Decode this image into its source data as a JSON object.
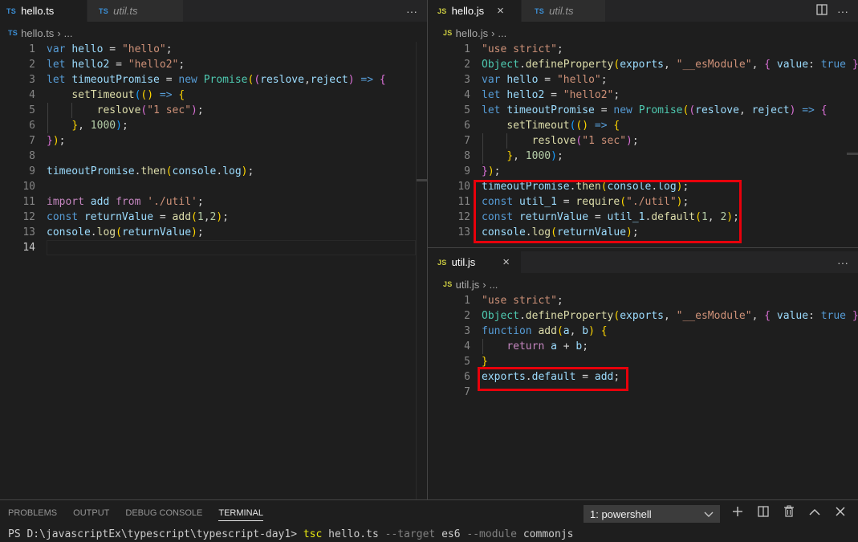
{
  "left_editor": {
    "tabs": [
      {
        "badge": "TS",
        "name": "hello.ts",
        "active": true
      },
      {
        "badge": "TS",
        "name": "util.ts",
        "active": false
      }
    ],
    "more_icon": "ellipsis-icon",
    "breadcrumb": {
      "badge": "TS",
      "file": "hello.ts",
      "rest": "..."
    },
    "lines": [
      {
        "n": "1",
        "html": "<span class=\"kw\">var</span> <span class=\"var\">hello</span> = <span class=\"str\">\"hello\"</span>;"
      },
      {
        "n": "2",
        "html": "<span class=\"kw\">let</span> <span class=\"var\">hello2</span> = <span class=\"str\">\"hello2\"</span>;"
      },
      {
        "n": "3",
        "html": "<span class=\"kw\">let</span> <span class=\"var\">timeoutPromise</span> = <span class=\"kw\">new</span> <span class=\"cls\">Promise</span><span class=\"p3\">(</span><span class=\"p1\">(</span><span class=\"var\">reslove</span>,<span class=\"var\">reject</span><span class=\"p1\">)</span> <span class=\"kw\">=&gt;</span> <span class=\"p1\">{</span>"
      },
      {
        "n": "4",
        "html": "    <span class=\"fn\">setTimeout</span><span class=\"p2\">(</span><span class=\"p3\">()</span> <span class=\"kw\">=&gt;</span> <span class=\"p3\">{</span>"
      },
      {
        "n": "5",
        "html": "        <span class=\"fn\">reslove</span><span class=\"p1\">(</span><span class=\"str\">\"1 sec\"</span><span class=\"p1\">)</span>;"
      },
      {
        "n": "6",
        "html": "    <span class=\"p3\">}</span>, <span class=\"num\">1000</span><span class=\"p2\">)</span>;"
      },
      {
        "n": "7",
        "html": "<span class=\"p1\">}</span><span class=\"p3\">)</span>;"
      },
      {
        "n": "8",
        "html": ""
      },
      {
        "n": "9",
        "html": "<span class=\"var\">timeoutPromise</span>.<span class=\"fn\">then</span><span class=\"p3\">(</span><span class=\"var\">console</span>.<span class=\"var\">log</span><span class=\"p3\">)</span>;"
      },
      {
        "n": "10",
        "html": ""
      },
      {
        "n": "11",
        "html": "<span class=\"ctl\">import</span> <span class=\"var\">add</span> <span class=\"ctl\">from</span> <span class=\"str\">'./util'</span>;"
      },
      {
        "n": "12",
        "html": "<span class=\"kw\">const</span> <span class=\"var\">returnValue</span> = <span class=\"fn\">add</span><span class=\"p3\">(</span><span class=\"num\">1</span>,<span class=\"num\">2</span><span class=\"p3\">)</span>;"
      },
      {
        "n": "13",
        "html": "<span class=\"var\">console</span>.<span class=\"fn\">log</span><span class=\"p3\">(</span><span class=\"var\">returnValue</span><span class=\"p3\">)</span>;"
      },
      {
        "n": "14",
        "html": ""
      }
    ]
  },
  "right_top_editor": {
    "tabs": [
      {
        "badge": "JS",
        "name": "hello.js",
        "active": true,
        "close": "×"
      },
      {
        "badge": "TS",
        "name": "util.ts",
        "active": false
      }
    ],
    "split_icon": "split-editor-icon",
    "more_icon": "ellipsis-icon",
    "breadcrumb": {
      "file": "hello.js",
      "rest": "..."
    },
    "lines": [
      {
        "n": "1",
        "html": "<span class=\"str\">\"use strict\"</span>;"
      },
      {
        "n": "2",
        "html": "<span class=\"cls\">Object</span>.<span class=\"fn\">defineProperty</span><span class=\"p3\">(</span><span class=\"var\">exports</span>, <span class=\"str\">\"__esModule\"</span>, <span class=\"p1\">{</span> <span class=\"var\">value</span>: <span class=\"kw\">true</span> <span class=\"p1\">}</span><span class=\"p3\">)</span>;"
      },
      {
        "n": "3",
        "html": "<span class=\"kw\">var</span> <span class=\"var\">hello</span> = <span class=\"str\">\"hello\"</span>;"
      },
      {
        "n": "4",
        "html": "<span class=\"kw\">let</span> <span class=\"var\">hello2</span> = <span class=\"str\">\"hello2\"</span>;"
      },
      {
        "n": "5",
        "html": "<span class=\"kw\">let</span> <span class=\"var\">timeoutPromise</span> = <span class=\"kw\">new</span> <span class=\"cls\">Promise</span><span class=\"p3\">(</span><span class=\"p1\">(</span><span class=\"var\">reslove</span>, <span class=\"var\">reject</span><span class=\"p1\">)</span> <span class=\"kw\">=&gt;</span> <span class=\"p1\">{</span>"
      },
      {
        "n": "6",
        "html": "    <span class=\"fn\">setTimeout</span><span class=\"p2\">(</span><span class=\"p3\">()</span> <span class=\"kw\">=&gt;</span> <span class=\"p3\">{</span>"
      },
      {
        "n": "7",
        "html": "        <span class=\"fn\">reslove</span><span class=\"p1\">(</span><span class=\"str\">\"1 sec\"</span><span class=\"p1\">)</span>;"
      },
      {
        "n": "8",
        "html": "    <span class=\"p3\">}</span>, <span class=\"num\">1000</span><span class=\"p2\">)</span>;"
      },
      {
        "n": "9",
        "html": "<span class=\"p1\">}</span><span class=\"p3\">)</span>;"
      },
      {
        "n": "10",
        "html": "<span class=\"var\">timeoutPromise</span>.<span class=\"fn\">then</span><span class=\"p3\">(</span><span class=\"var\">console</span>.<span class=\"var\">log</span><span class=\"p3\">)</span>;"
      },
      {
        "n": "11",
        "html": "<span class=\"kw\">const</span> <span class=\"var\">util_1</span> = <span class=\"fn\">require</span><span class=\"p3\">(</span><span class=\"str\">\"./util\"</span><span class=\"p3\">)</span>;"
      },
      {
        "n": "12",
        "html": "<span class=\"kw\">const</span> <span class=\"var\">returnValue</span> = <span class=\"var\">util_1</span>.<span class=\"fn\">default</span><span class=\"p3\">(</span><span class=\"num\">1</span>, <span class=\"num\">2</span><span class=\"p3\">)</span>;"
      },
      {
        "n": "13",
        "html": "<span class=\"var\">console</span>.<span class=\"fn\">log</span><span class=\"p3\">(</span><span class=\"var\">returnValue</span><span class=\"p3\">)</span>;"
      }
    ]
  },
  "right_bottom_editor": {
    "tabs": [
      {
        "badge": "JS",
        "name": "util.js",
        "active": true,
        "close": "×"
      }
    ],
    "more_icon": "ellipsis-icon",
    "breadcrumb": {
      "file": "util.js",
      "rest": "..."
    },
    "lines": [
      {
        "n": "1",
        "html": "<span class=\"str\">\"use strict\"</span>;"
      },
      {
        "n": "2",
        "html": "<span class=\"cls\">Object</span>.<span class=\"fn\">defineProperty</span><span class=\"p3\">(</span><span class=\"var\">exports</span>, <span class=\"str\">\"__esModule\"</span>, <span class=\"p1\">{</span> <span class=\"var\">value</span>: <span class=\"kw\">true</span> <span class=\"p1\">}</span><span class=\"p3\">)</span>;"
      },
      {
        "n": "3",
        "html": "<span class=\"kw\">function</span> <span class=\"fn\">add</span><span class=\"p3\">(</span><span class=\"var\">a</span>, <span class=\"var\">b</span><span class=\"p3\">)</span> <span class=\"p3\">{</span>"
      },
      {
        "n": "4",
        "html": "    <span class=\"ctl\">return</span> <span class=\"var\">a</span> + <span class=\"var\">b</span>;"
      },
      {
        "n": "5",
        "html": "<span class=\"p3\">}</span>"
      },
      {
        "n": "6",
        "html": "<span class=\"var\">exports</span>.<span class=\"var\">default</span> = <span class=\"var\">add</span>;"
      },
      {
        "n": "7",
        "html": ""
      }
    ]
  },
  "panel": {
    "tabs": [
      "PROBLEMS",
      "OUTPUT",
      "DEBUG CONSOLE",
      "TERMINAL"
    ],
    "active_tab": "TERMINAL",
    "terminal_select": "1: powershell",
    "actions": [
      "add-terminal-icon",
      "split-terminal-icon",
      "trash-icon",
      "maximize-panel-icon",
      "close-panel-icon"
    ],
    "terminal": {
      "prompt": "PS D:\\javascriptEx\\typescript\\typescript-day1> ",
      "cmd": "tsc",
      "arg1": " hello.ts ",
      "flag1": "--target",
      "arg2": " es6 ",
      "flag2": "--module",
      "arg3": " commonjs"
    }
  },
  "colors": {
    "editor_bg": "#1e1e1e",
    "tab_bg": "#252526",
    "highlight_box": "#e8000b"
  }
}
